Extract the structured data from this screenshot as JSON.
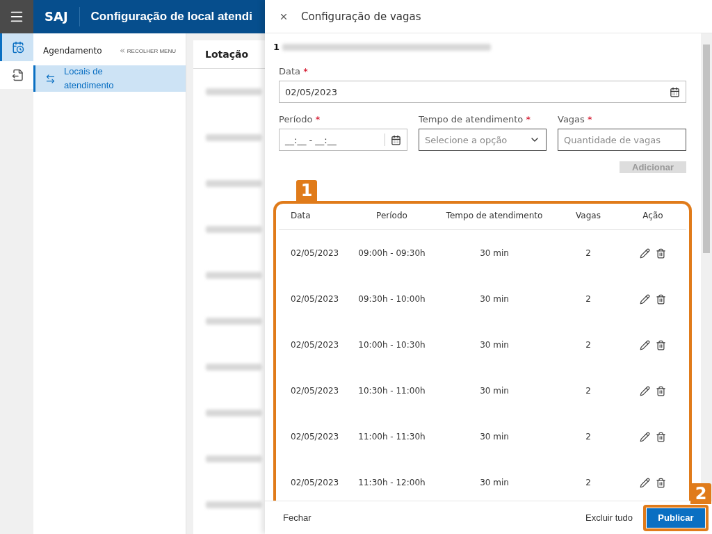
{
  "header": {
    "brand": "SAJ",
    "title": "Configuração de local atendi"
  },
  "rail": [
    {
      "kind": "calendar",
      "selected": true
    },
    {
      "kind": "export",
      "selected": false
    }
  ],
  "sidebar": {
    "section": "Agendamento",
    "collapse": "RECOLHER MENU",
    "items": [
      {
        "label": "Locais de atendimento",
        "selected": true
      }
    ]
  },
  "main": {
    "column": "Lotação"
  },
  "required_mark": "*",
  "drawer": {
    "title": "Configuração de vagas",
    "subtitle": "1",
    "fields": {
      "date": {
        "label": "Data",
        "value": "02/05/2023"
      },
      "period": {
        "label": "Período",
        "value": "__:__ - __:__"
      },
      "duration": {
        "label": "Tempo de atendimento",
        "placeholder": "Selecione a opção"
      },
      "slots": {
        "label": "Vagas",
        "placeholder": "Quantidade de vagas"
      }
    },
    "add_button": {
      "label": "Adicionar",
      "disabled": true
    },
    "table": {
      "columns": [
        "Data",
        "Período",
        "Tempo de atendimento",
        "Vagas",
        "Ação"
      ],
      "rows": [
        {
          "date": "02/05/2023",
          "period": "09:00h - 09:30h",
          "duration": "30 min",
          "slots": "2"
        },
        {
          "date": "02/05/2023",
          "period": "09:30h - 10:00h",
          "duration": "30 min",
          "slots": "2"
        },
        {
          "date": "02/05/2023",
          "period": "10:00h - 10:30h",
          "duration": "30 min",
          "slots": "2"
        },
        {
          "date": "02/05/2023",
          "period": "10:30h - 11:00h",
          "duration": "30 min",
          "slots": "2"
        },
        {
          "date": "02/05/2023",
          "period": "11:00h - 11:30h",
          "duration": "30 min",
          "slots": "2"
        },
        {
          "date": "02/05/2023",
          "period": "11:30h - 12:00h",
          "duration": "30 min",
          "slots": "2"
        }
      ]
    },
    "footer": {
      "close": "Fechar",
      "delete_all": "Excluir tudo",
      "publish": "Publicar"
    }
  },
  "annotations": [
    "1",
    "2"
  ]
}
